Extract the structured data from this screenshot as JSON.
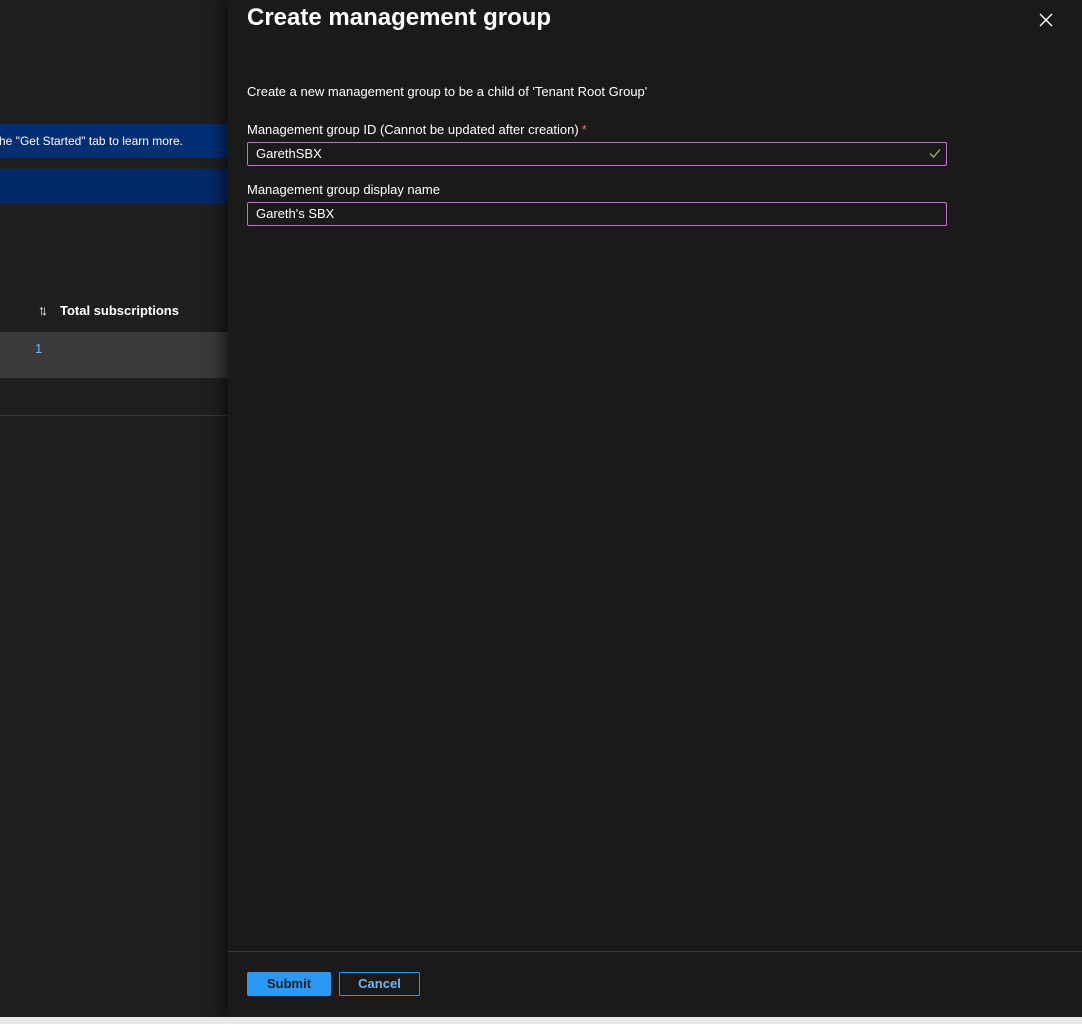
{
  "background": {
    "banner_text": "he \"Get Started\" tab to learn more.",
    "column_header": "Total subscriptions",
    "row_value": "1"
  },
  "panel": {
    "title": "Create management group",
    "description": "Create a new management group to be a child of 'Tenant Root Group'",
    "fields": [
      {
        "label": "Management group ID (Cannot be updated after creation)",
        "required_marker": "*",
        "value": "GarethSBX",
        "valid": true
      },
      {
        "label": "Management group display name",
        "value": "Gareth's SBX"
      }
    ],
    "submit_label": "Submit",
    "cancel_label": "Cancel"
  },
  "colors": {
    "accent": "#2899f5",
    "input_border": "#c86dd7",
    "required": "#f1707b",
    "valid_check": "#92c353",
    "banner": "#002f73"
  }
}
